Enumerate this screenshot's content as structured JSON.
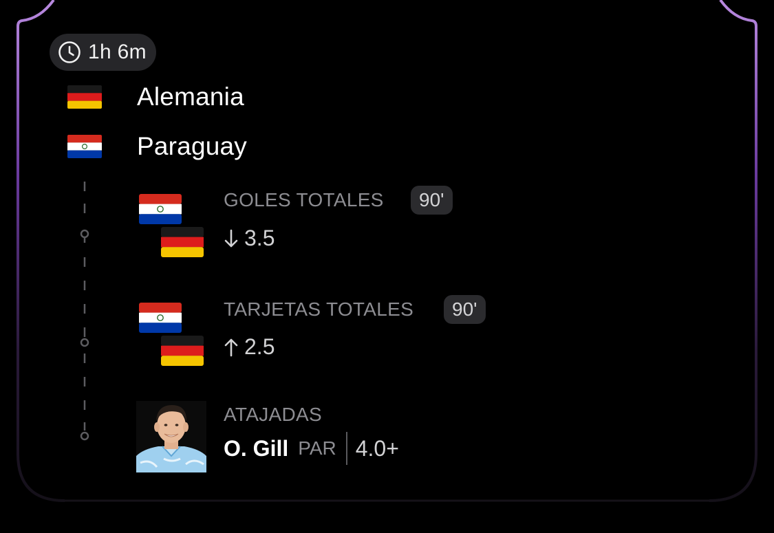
{
  "header": {
    "elapsed": "1h 6m"
  },
  "teams": [
    {
      "name": "Alemania",
      "flag": "germany-flag"
    },
    {
      "name": "Paraguay",
      "flag": "paraguay-flag"
    }
  ],
  "markets": [
    {
      "title": "GOLES TOTALES",
      "minute": "90'",
      "direction": "down-arrow-icon",
      "line": "3.5"
    },
    {
      "title": "TARJETAS TOTALES",
      "minute": "90'",
      "direction": "up-arrow-icon",
      "line": "2.5"
    }
  ],
  "player_market": {
    "title": "ATAJADAS",
    "player": "O. Gill",
    "team": "PAR",
    "line": "4.0+"
  },
  "colors": {
    "frame_top": "#b98ae0",
    "frame_mid": "#5b2e8c",
    "pill_bg": "#262629",
    "muted_text": "#8d8d92"
  }
}
